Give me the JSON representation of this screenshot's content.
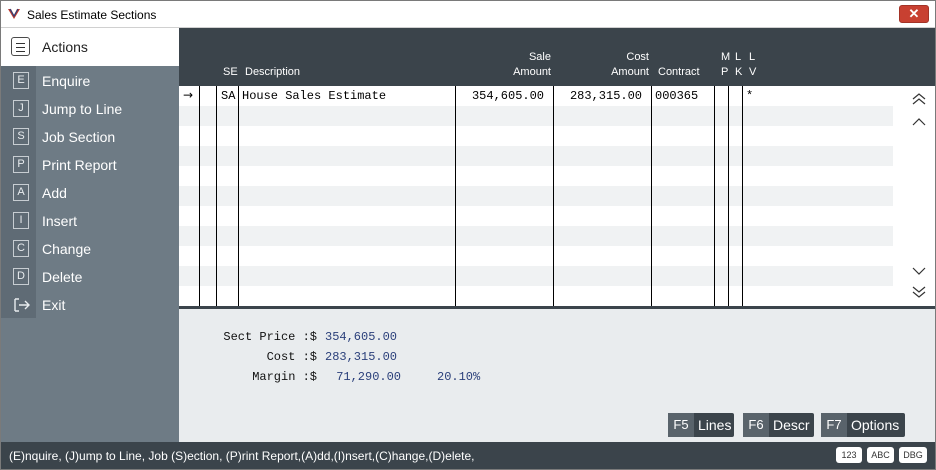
{
  "window": {
    "title": "Sales Estimate Sections",
    "close_label": "✕"
  },
  "sidebar": {
    "header": "Actions",
    "items": [
      {
        "key": "E",
        "label": "Enquire"
      },
      {
        "key": "J",
        "label": "Jump to Line"
      },
      {
        "key": "S",
        "label": "Job Section"
      },
      {
        "key": "P",
        "label": "Print Report"
      },
      {
        "key": "A",
        "label": "Add"
      },
      {
        "key": "I",
        "label": "Insert"
      },
      {
        "key": "C",
        "label": "Change"
      },
      {
        "key": "D",
        "label": "Delete"
      }
    ],
    "exit_label": "Exit"
  },
  "grid": {
    "columns": {
      "se": "SE",
      "description": "Description",
      "sale_top": "Sale",
      "sale_bottom": "Amount",
      "cost_top": "Cost",
      "cost_bottom": "Amount",
      "contract": "Contract",
      "mp_top": "M",
      "mp_bottom": "P",
      "lk_top": "L",
      "lk_bottom": "K",
      "lv_top": "L",
      "lv_bottom": "V"
    },
    "rows": [
      {
        "pointer": "→",
        "se": "SA",
        "description": "House Sales Estimate",
        "sale_amount": "354,605.00",
        "cost_amount": "283,315.00",
        "contract": "000365",
        "mp": "",
        "lk": "",
        "lv": "*"
      }
    ]
  },
  "totals": {
    "sect_price_label": "Sect Price :$",
    "sect_price": "354,605.00",
    "cost_label": "Cost :$",
    "cost": "283,315.00",
    "margin_label": "Margin :$",
    "margin": "71,290.00",
    "margin_pct": "20.10%"
  },
  "function_keys": [
    {
      "key": "F5",
      "label": "Lines"
    },
    {
      "key": "F6",
      "label": "Descr"
    },
    {
      "key": "F7",
      "label": "Options"
    }
  ],
  "statusbar": {
    "text": "(E)nquire, (J)ump to Line, Job (S)ection, (P)rint Report,(A)dd,(I)nsert,(C)hange,(D)elete,",
    "badges": [
      "123",
      "ABC",
      "DBG"
    ]
  }
}
